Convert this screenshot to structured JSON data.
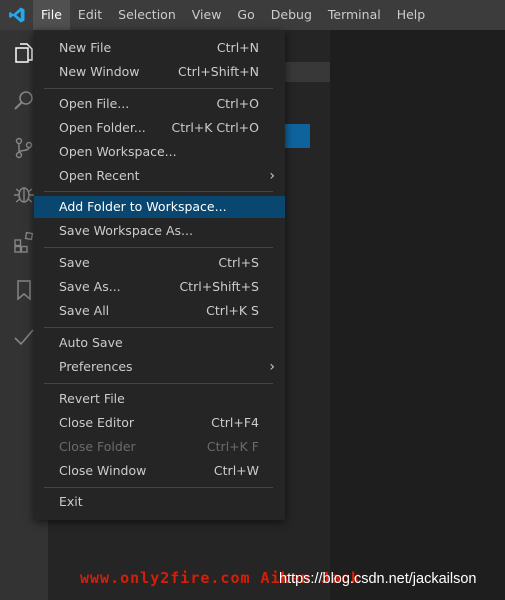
{
  "menubar": {
    "items": [
      "File",
      "Edit",
      "Selection",
      "View",
      "Go",
      "Debug",
      "Terminal",
      "Help"
    ]
  },
  "file_menu": {
    "items": [
      {
        "label": "New File",
        "shortcut": "Ctrl+N"
      },
      {
        "label": "New Window",
        "shortcut": "Ctrl+Shift+N"
      },
      {
        "label": "Open File...",
        "shortcut": "Ctrl+O"
      },
      {
        "label": "Open Folder...",
        "shortcut": "Ctrl+K Ctrl+O"
      },
      {
        "label": "Open Workspace...",
        "shortcut": ""
      },
      {
        "label": "Open Recent",
        "shortcut": "",
        "submenu_arrow": "›"
      },
      {
        "label": "Add Folder to Workspace...",
        "shortcut": ""
      },
      {
        "label": "Save Workspace As...",
        "shortcut": ""
      },
      {
        "label": "Save",
        "shortcut": "Ctrl+S"
      },
      {
        "label": "Save As...",
        "shortcut": "Ctrl+Shift+S"
      },
      {
        "label": "Save All",
        "shortcut": "Ctrl+K S"
      },
      {
        "label": "Auto Save",
        "shortcut": ""
      },
      {
        "label": "Preferences",
        "shortcut": "",
        "submenu_arrow": "›"
      },
      {
        "label": "Revert File",
        "shortcut": ""
      },
      {
        "label": "Close Editor",
        "shortcut": "Ctrl+F4"
      },
      {
        "label": "Close Folder",
        "shortcut": "Ctrl+K F"
      },
      {
        "label": "Close Window",
        "shortcut": "Ctrl+W"
      },
      {
        "label": "Exit",
        "shortcut": ""
      }
    ]
  },
  "activity_icons": [
    "explorer-icon",
    "search-icon",
    "source-control-icon",
    "debug-icon",
    "extensions-icon",
    "bookmark-icon",
    "check-icon"
  ],
  "watermark": {
    "red_text": "www.only2fire.com Aiken Jack",
    "url_text": "https://blog.csdn.net/jackailson"
  },
  "colors": {
    "menu_highlight": "#094771",
    "app_logo": "#23a9f2",
    "watermark_red": "#d81e06"
  }
}
